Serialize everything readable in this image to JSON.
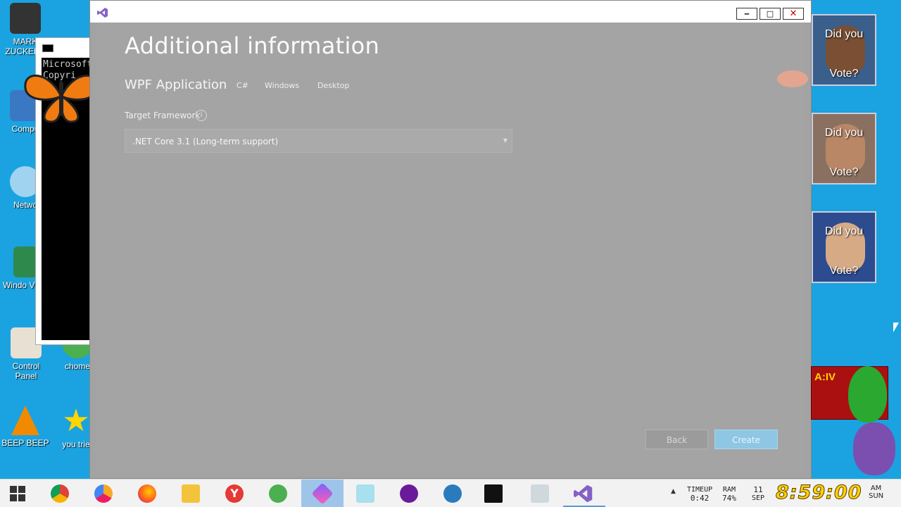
{
  "desktop": {
    "icons": [
      {
        "label": "MARK ZUCKERB",
        "icon": "person-icon"
      },
      {
        "label": "Compu",
        "icon": "computer-icon"
      },
      {
        "label": "Netwo",
        "icon": "network-icon"
      },
      {
        "label": "Windo Vista",
        "icon": "recycle-bin-icon"
      },
      {
        "label": "Control Panel",
        "icon": "control-panel-icon"
      },
      {
        "label": "chome",
        "icon": "chrome-icon"
      },
      {
        "label": "BEEP BEEP",
        "icon": "vlc-cone-icon"
      },
      {
        "label": "you trie",
        "icon": "star-icon"
      }
    ],
    "cmd_window": {
      "line1": "Microsoft",
      "line2": "Copyri"
    },
    "vote_widgets": [
      {
        "top_text": "Did you",
        "bottom_text": "Vote?"
      },
      {
        "top_text": "Did you",
        "bottom_text": "Vote?"
      },
      {
        "top_text": "Did you",
        "bottom_text": "Vote?"
      }
    ],
    "gta_widget": {
      "title": "A:IV"
    }
  },
  "vs_window": {
    "controls": {
      "minimize": "‒",
      "maximize": "□",
      "close": "✕"
    },
    "heading": "Additional information",
    "project_type": "WPF Application",
    "tags": [
      "C#",
      "Windows",
      "Desktop"
    ],
    "framework_label": "Target Framework",
    "framework_info": "i",
    "framework_value": ".NET Core 3.1 (Long-term support)",
    "back_label": "Back",
    "create_label": "Create"
  },
  "taskbar": {
    "apps": [
      "windows-start-icon",
      "chrome-icon",
      "chrome-canary-icon",
      "firefox-icon",
      "file-explorer-icon",
      "yandex-icon",
      "ccleaner-icon",
      "prism-app-icon",
      "folder-icon",
      "yahoo-messenger-icon",
      "bluestacks-icon",
      "cmd-icon",
      "downloader-icon",
      "visual-studio-icon"
    ],
    "timeup_label": "TIMEUP",
    "timeup_value": "0:42",
    "ram_label": "RAM",
    "ram_value": "74%",
    "date_day": "11",
    "date_month": "SEP",
    "clock": "8:59:00",
    "ampm": "AM",
    "weekday": "SUN"
  }
}
